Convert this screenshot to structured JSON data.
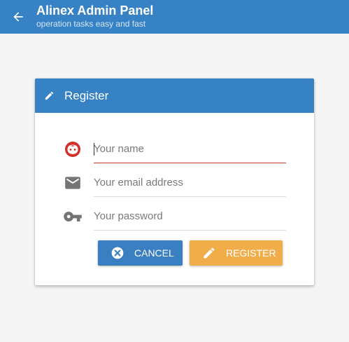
{
  "header": {
    "title": "Alinex Admin Panel",
    "subtitle": "operation tasks easy and fast",
    "back_icon": "arrow-left-icon",
    "color": "#3682c4"
  },
  "card": {
    "title": "Register",
    "title_icon": "pencil-icon",
    "fields": {
      "name": {
        "placeholder": "Your name",
        "value": "",
        "icon": "face-icon",
        "icon_color": "#d32f2f"
      },
      "email": {
        "placeholder": "Your email address",
        "value": "",
        "icon": "email-icon",
        "icon_color": "#757575"
      },
      "password": {
        "placeholder": "Your password",
        "value": "",
        "icon": "key-icon",
        "icon_color": "#757575"
      }
    },
    "buttons": {
      "cancel": {
        "label": "Cancel",
        "icon": "cancel-circle-icon",
        "color": "#3a7fc1"
      },
      "register": {
        "label": "Register",
        "icon": "pencil-icon",
        "color": "#f2ad4b"
      }
    }
  }
}
